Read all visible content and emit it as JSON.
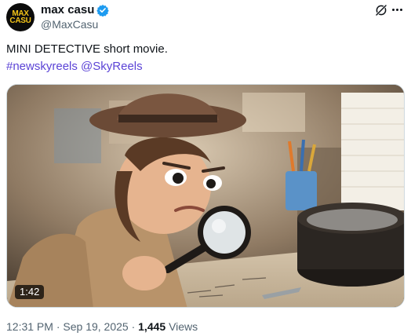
{
  "author": {
    "display_name": "max casu",
    "handle": "@MaxCasu",
    "avatar_text": "MAX\nCASU",
    "verified_color": "#1d9bf0"
  },
  "post": {
    "text": "MINI DETECTIVE short movie.",
    "hashtag": "#newskyreels",
    "mention": "@SkyReels",
    "link_color": "#5b43d6"
  },
  "media": {
    "duration": "1:42"
  },
  "meta": {
    "time": "12:31 PM",
    "separator": "·",
    "date": "Sep 19, 2025",
    "views_count": "1,445",
    "views_label": "Views"
  },
  "icons": [
    "verified-badge-icon",
    "grok-icon",
    "more-icon"
  ]
}
